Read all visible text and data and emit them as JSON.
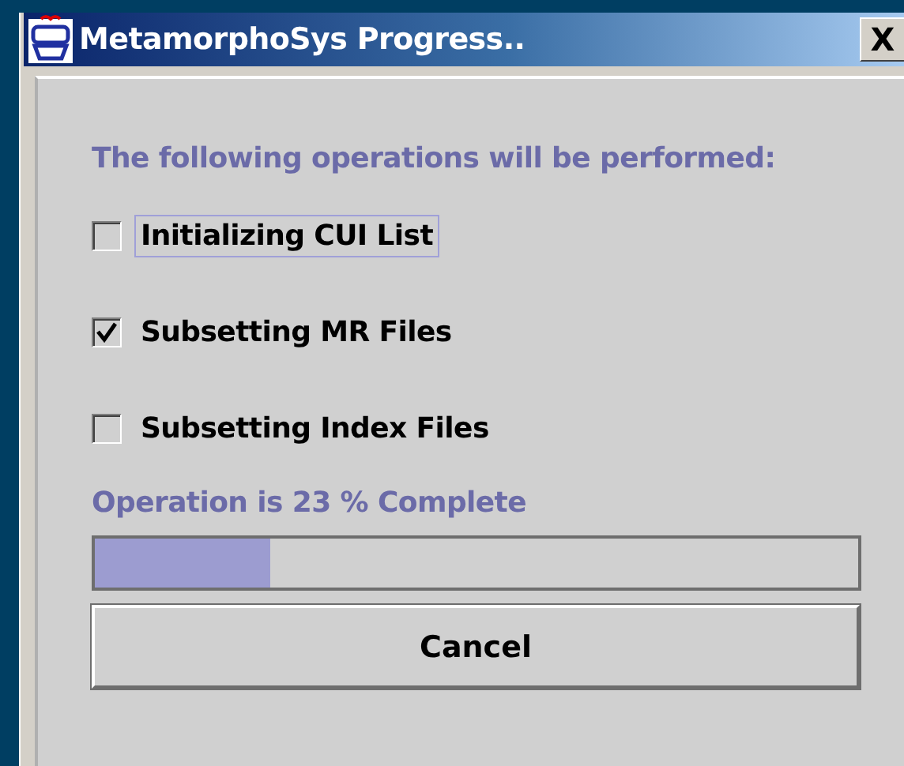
{
  "window": {
    "title": "MetamorphoSys Progress..",
    "close": "X"
  },
  "heading": "The following operations will be performed:",
  "operations": [
    {
      "label": "Initializing CUI List",
      "checked": false,
      "focused": true
    },
    {
      "label": "Subsetting MR Files",
      "checked": true,
      "focused": false
    },
    {
      "label": "Subsetting Index Files",
      "checked": false,
      "focused": false
    }
  ],
  "progress": {
    "label": "Operation is 23 % Complete",
    "level": 0.23
  },
  "buttons": [
    "Cancel"
  ]
}
